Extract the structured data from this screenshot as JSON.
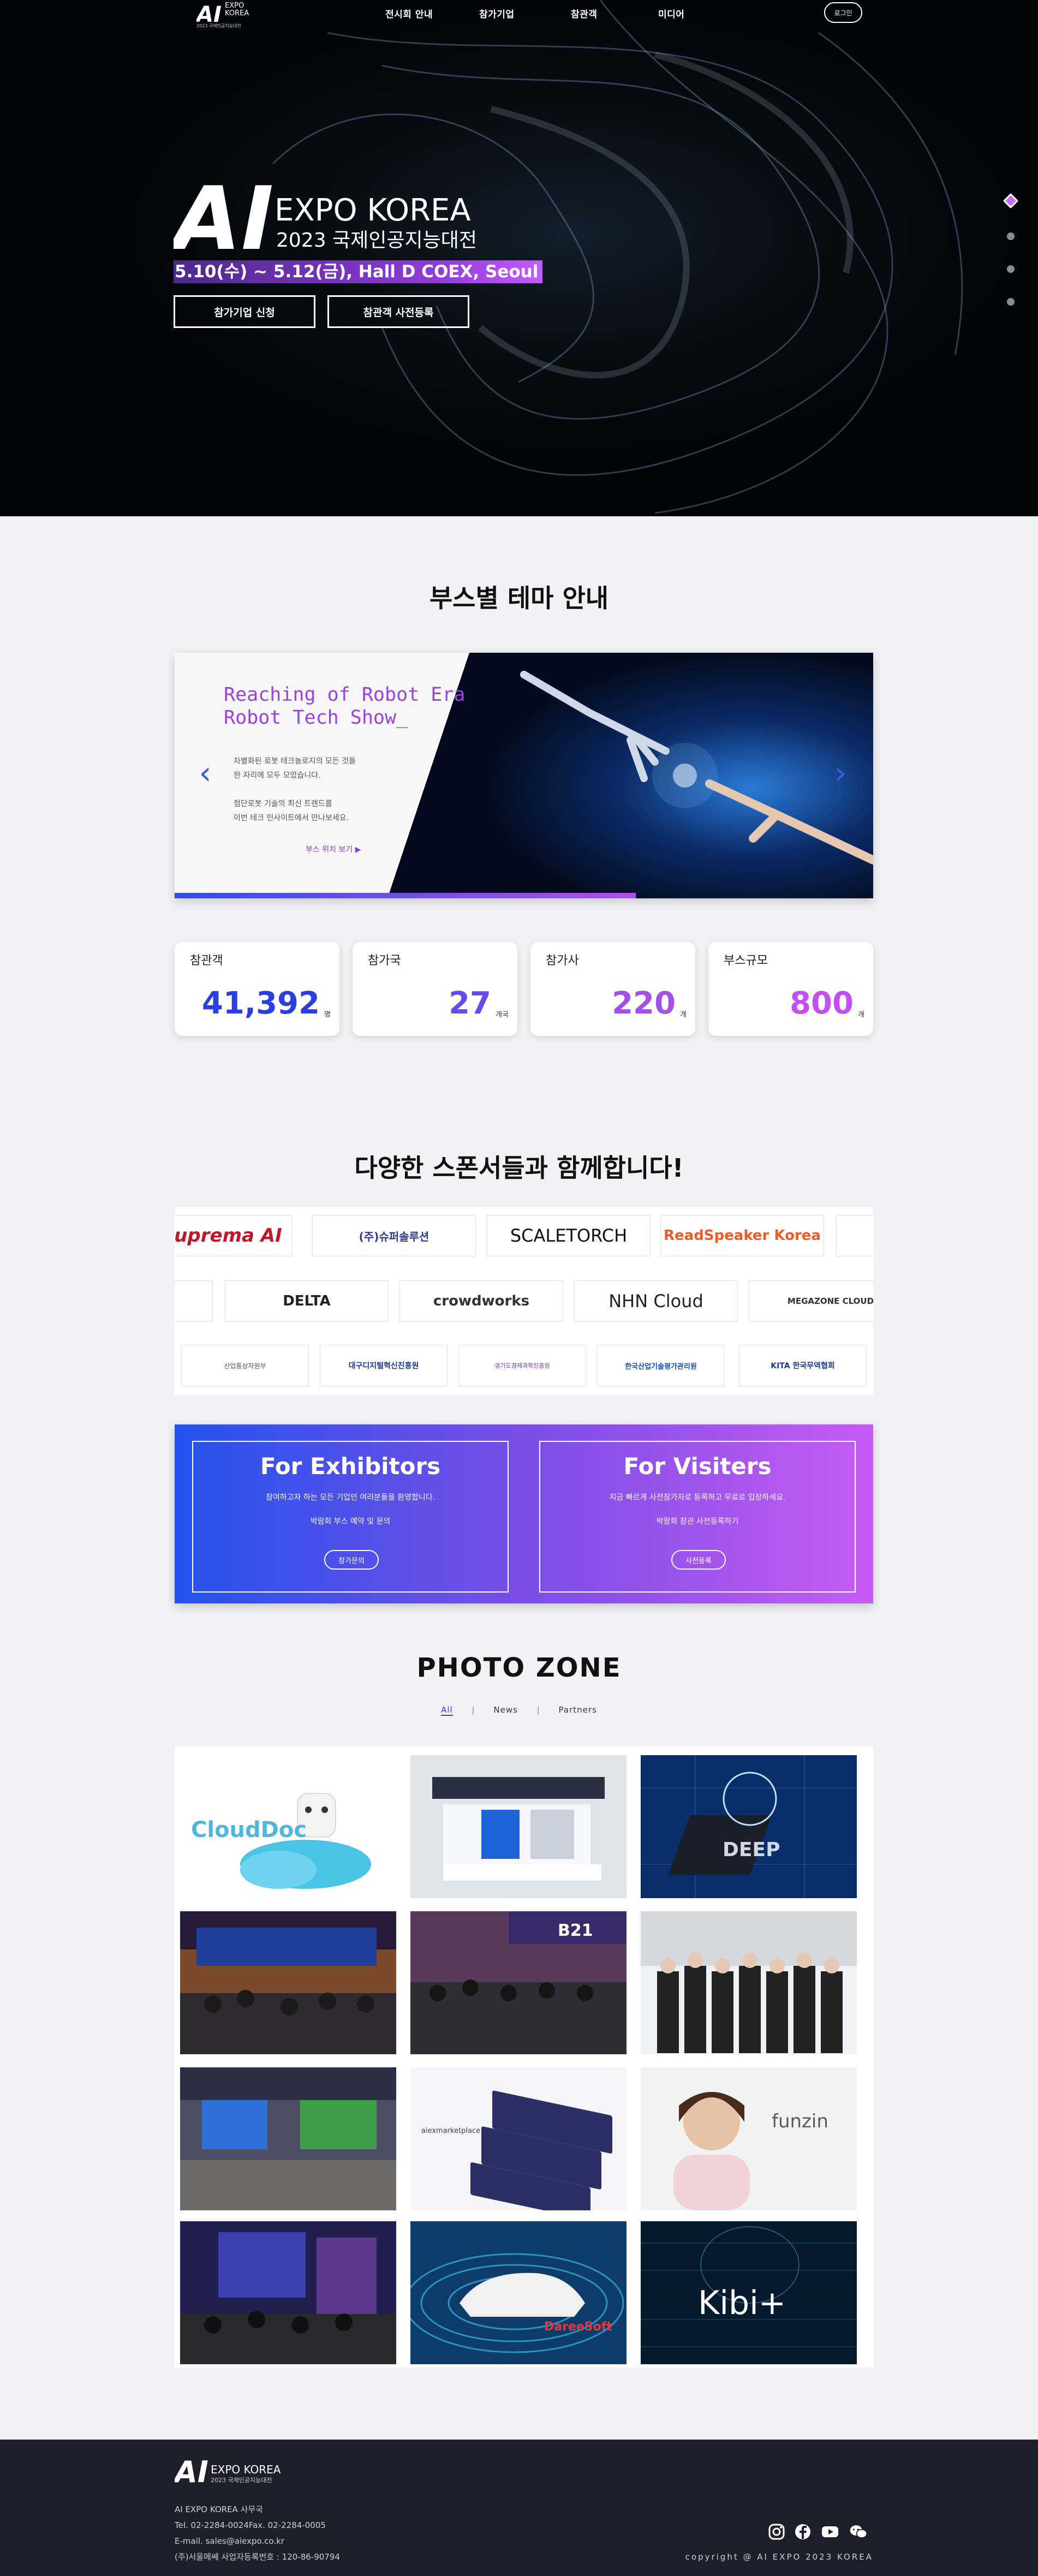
{
  "nav": {
    "logo": {
      "ai": "AI",
      "expo": "EXPO",
      "korea": "KOREA",
      "sub": "2023 국제인공지능대전"
    },
    "items": [
      {
        "label": "전시회 안내"
      },
      {
        "label": "참가기업"
      },
      {
        "label": "참관객"
      },
      {
        "label": "미디어"
      }
    ],
    "login": "로그인"
  },
  "hero": {
    "logo": {
      "ai": "AI",
      "title": "EXPO KOREA",
      "sub": "2023 국제인공지능대전"
    },
    "date": "5.10(수) ~ 5.12(금), Hall D COEX, Seoul",
    "buttons": [
      "참가기업 신청",
      "참관객 사전등록"
    ],
    "slide_count": 4,
    "active_slide": 1
  },
  "theme": {
    "title": "부스별 테마 안내",
    "heading_line1": "Reaching of Robot Era",
    "heading_line2": "Robot Tech Show_",
    "text": [
      "차별화된 로봇 테크놀로지의 모든 것들",
      "한 자리에 모두 모았습니다.",
      "",
      "첨단로봇 기술의 최신 트렌드를",
      "이번 테크 인사이트에서 만나보세요."
    ],
    "link": "부스 위치 보기 ▶",
    "progress": 0.66,
    "colors": {
      "heading": "#9e3fe0",
      "arrow": "#3a5ce0"
    }
  },
  "stats": [
    {
      "label": "참관객",
      "value": "41,392",
      "unit": "명",
      "color": "#2b3fe0"
    },
    {
      "label": "참가국",
      "value": "27",
      "unit": "개국",
      "color": "#6a4ae6"
    },
    {
      "label": "참가사",
      "value": "220",
      "unit": "개",
      "color": "#a34fea"
    },
    {
      "label": "부스규모",
      "value": "800",
      "unit": "개",
      "color": "#c44ff0"
    }
  ],
  "sponsors": {
    "title": "다양한 스폰서들과 함께합니다!",
    "row1": [
      "uprema AI",
      "(주)슈퍼솔루션",
      "SCALETORCH",
      "ReadSpeaker Korea"
    ],
    "row2": [
      "DELTA",
      "crowdworks",
      "NHN Cloud",
      "MEGAZONE CLOUD"
    ],
    "row3": [
      "산업통상자원부",
      "대구디지털혁신진흥원",
      "경기도경제과학진흥원",
      "한국산업기술평가관리원",
      "KITA 한국무역협회"
    ]
  },
  "cta": {
    "exhibitors": {
      "title": "For Exhibitors",
      "line1": "참여하고자 하는 모든 기업인 여러분들을 환영합니다.",
      "line2": "박람회 부스 예약 및 문의",
      "button": "참가문의"
    },
    "visitors": {
      "title": "For Visiters",
      "line1": "지금 빠르게 사전참가자로 등록하고 무료로 입장하세요.",
      "line2": "박람회 참관 사전등록하기",
      "button": "사전등록"
    }
  },
  "photo_zone": {
    "title": "PHOTO ZONE",
    "tabs": [
      "All",
      "News",
      "Partners"
    ],
    "active_tab": "All",
    "photos": [
      {
        "name": "clouddoc-photo",
        "text": "CloudDoc"
      },
      {
        "name": "booth-render-photo",
        "text": ""
      },
      {
        "name": "deep-chip-photo",
        "text": "DEEP"
      },
      {
        "name": "exhibition-crowd-photo",
        "text": ""
      },
      {
        "name": "booth-b21-photo",
        "text": "B21"
      },
      {
        "name": "group-photo",
        "text": ""
      },
      {
        "name": "exhibition-hall-photo",
        "text": ""
      },
      {
        "name": "marketplace-photo",
        "text": "aiexmarketplace"
      },
      {
        "name": "funzin-photo",
        "text": "funzin"
      },
      {
        "name": "conference-photo",
        "text": ""
      },
      {
        "name": "dareesoft-car-photo",
        "text": "DareeSoft"
      },
      {
        "name": "kibit-photo",
        "text": "Kibi+"
      }
    ]
  },
  "footer": {
    "logo": {
      "ai": "AI",
      "title": "EXPO KOREA",
      "sub": "2023 국제인공지능대전"
    },
    "info": [
      "AI EXPO KOREA 사무국",
      "Tel. 02-2284-0024Fax. 02-2284-0005",
      "E-mail. sales@aiexpo.co.kr",
      "(주)서울메쎄 사업자등록번호 : 120-86-90794"
    ],
    "copyright": "copyright @ AI EXPO 2023 KOREA",
    "socials": [
      "instagram-icon",
      "facebook-icon",
      "youtube-icon",
      "wechat-icon"
    ]
  }
}
